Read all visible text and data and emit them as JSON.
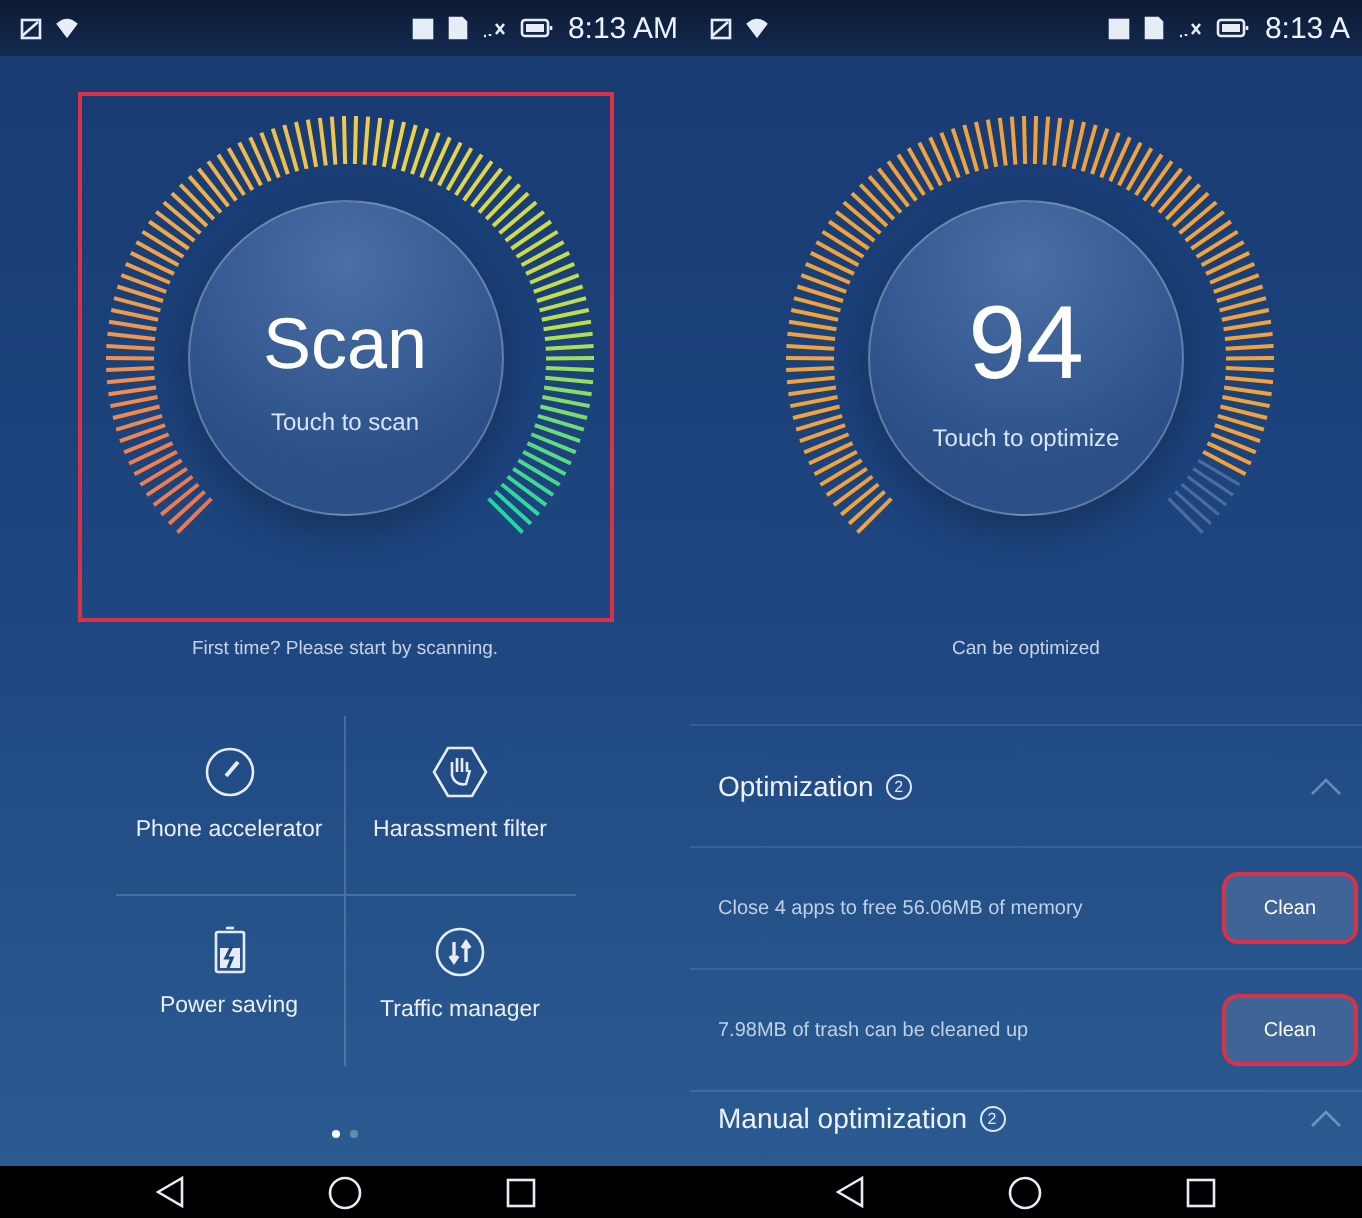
{
  "screens": [
    {
      "kind": "home",
      "status_bar": {
        "time": "8:13 AM"
      },
      "gauge": {
        "kind": "scan",
        "value": "Scan",
        "hint": "Touch to scan",
        "highlighted": true
      },
      "caption": "First time? Please start by scanning.",
      "tools": [
        {
          "label": "Phone accelerator"
        },
        {
          "label": "Harassment filter"
        },
        {
          "label": "Power saving"
        },
        {
          "label": "Traffic manager"
        }
      ],
      "page_dots": [
        {
          "selected": true
        },
        {
          "selected": false
        }
      ]
    },
    {
      "kind": "result",
      "status_bar": {
        "time": "8:13 A"
      },
      "gauge": {
        "kind": "score",
        "value": "94",
        "hint": "Touch to optimize",
        "highlighted": false
      },
      "caption": "Can be optimized",
      "sections": [
        {
          "title": "Optimization",
          "count": "2",
          "expanded": true,
          "items": [
            {
              "text": "Close 4 apps to free 56.06MB of memory",
              "action": "Clean",
              "highlighted": true
            },
            {
              "text": "7.98MB of trash can be cleaned up",
              "action": "Clean",
              "highlighted": true
            }
          ]
        },
        {
          "title": "Manual optimization",
          "count": "2",
          "expanded": true
        }
      ]
    }
  ]
}
